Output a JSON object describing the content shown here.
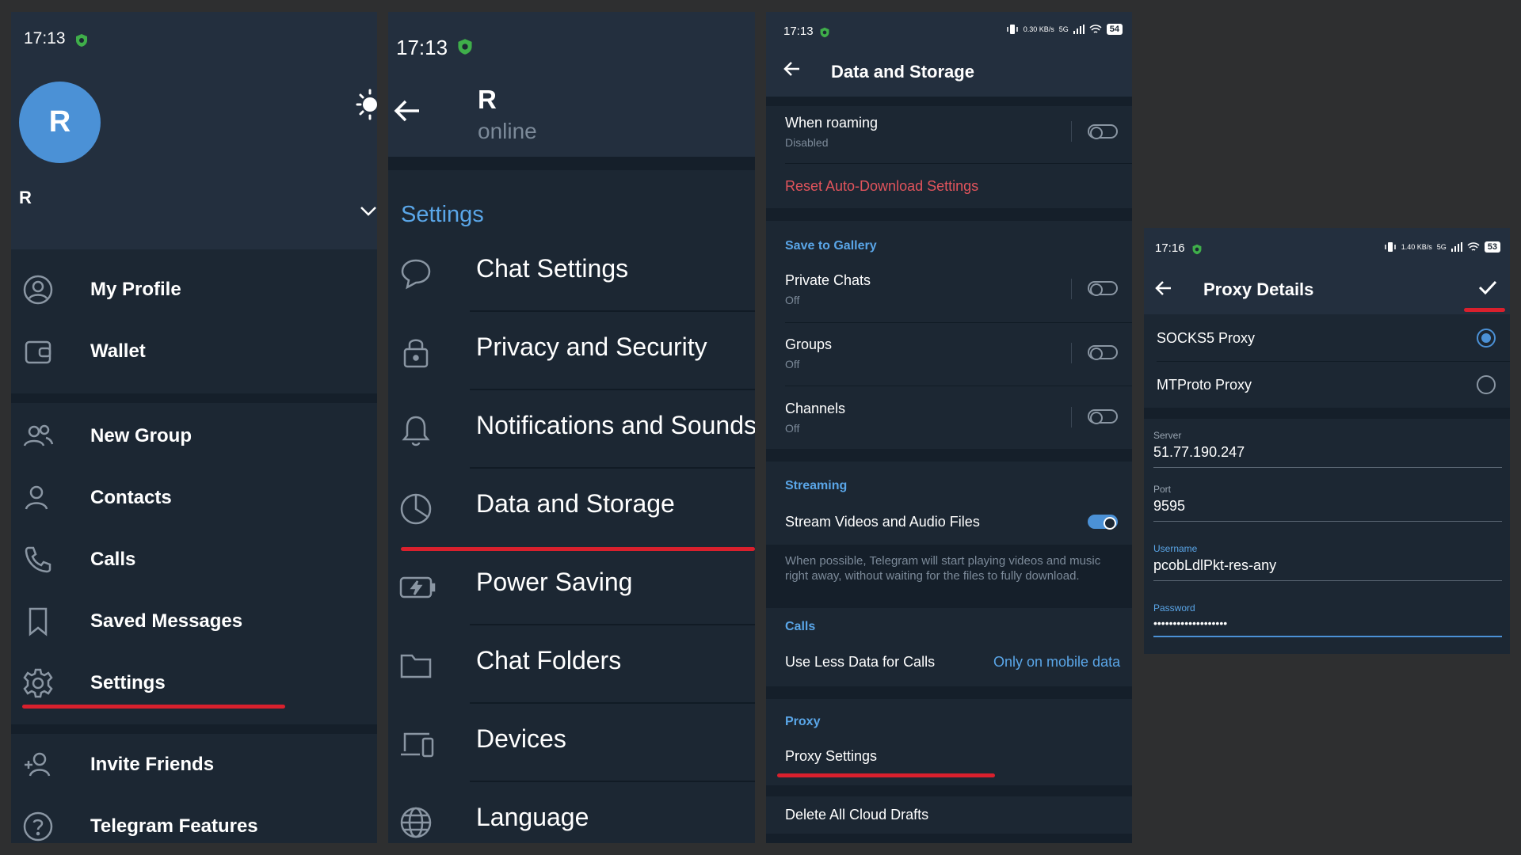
{
  "colors": {
    "accent": "#4b91d6",
    "highlight": "#d9202d",
    "destructive": "#e2545c",
    "bg": "#1c2733"
  },
  "drawer": {
    "time": "17:13",
    "avatar_letter": "R",
    "user_name": "R",
    "items": [
      {
        "label": "My Profile",
        "icon": "profile-icon"
      },
      {
        "label": "Wallet",
        "icon": "wallet-icon"
      },
      {
        "label": "New Group",
        "icon": "group-icon"
      },
      {
        "label": "Contacts",
        "icon": "contact-icon"
      },
      {
        "label": "Calls",
        "icon": "phone-icon"
      },
      {
        "label": "Saved Messages",
        "icon": "bookmark-icon"
      },
      {
        "label": "Settings",
        "icon": "gear-icon"
      },
      {
        "label": "Invite Friends",
        "icon": "add-person-icon"
      },
      {
        "label": "Telegram Features",
        "icon": "question-icon"
      }
    ]
  },
  "settings": {
    "time": "17:13",
    "title": "R",
    "subtitle": "online",
    "section": "Settings",
    "items": [
      {
        "label": "Chat Settings",
        "icon": "chat-bubble-icon"
      },
      {
        "label": "Privacy and Security",
        "icon": "lock-icon"
      },
      {
        "label": "Notifications and Sounds",
        "icon": "bell-icon"
      },
      {
        "label": "Data and Storage",
        "icon": "pie-chart-icon"
      },
      {
        "label": "Power Saving",
        "icon": "battery-icon"
      },
      {
        "label": "Chat Folders",
        "icon": "folder-icon"
      },
      {
        "label": "Devices",
        "icon": "devices-icon"
      },
      {
        "label": "Language",
        "icon": "globe-icon"
      }
    ]
  },
  "data_storage": {
    "time": "17:13",
    "battery": "54",
    "net_speed": "0.30 KB/s",
    "net_type": "5G",
    "title": "Data and Storage",
    "roaming": {
      "label": "When roaming",
      "value": "Disabled"
    },
    "reset_label": "Reset Auto-Download Settings",
    "gallery": {
      "section": "Save to Gallery",
      "items": [
        {
          "label": "Private Chats",
          "value": "Off"
        },
        {
          "label": "Groups",
          "value": "Off"
        },
        {
          "label": "Channels",
          "value": "Off"
        }
      ]
    },
    "streaming": {
      "section": "Streaming",
      "label": "Stream Videos and Audio Files",
      "hint": "When possible, Telegram will start playing videos and music right away, without waiting for the files to fully download."
    },
    "calls": {
      "section": "Calls",
      "label": "Use Less Data for Calls",
      "value": "Only on mobile data"
    },
    "proxy": {
      "section": "Proxy",
      "label": "Proxy Settings"
    },
    "drafts_label": "Delete All Cloud Drafts"
  },
  "proxy_details": {
    "time": "17:16",
    "battery": "53",
    "net_speed": "1.40 KB/s",
    "net_type": "5G",
    "title": "Proxy Details",
    "options": [
      "SOCKS5 Proxy",
      "MTProto Proxy"
    ],
    "server": {
      "label": "Server",
      "value": "51.77.190.247"
    },
    "port": {
      "label": "Port",
      "value": "9595"
    },
    "username": {
      "label": "Username",
      "value": "pcobLdlPkt-res-any"
    },
    "password": {
      "label": "Password",
      "value": "•••••••••••••••••••"
    }
  }
}
